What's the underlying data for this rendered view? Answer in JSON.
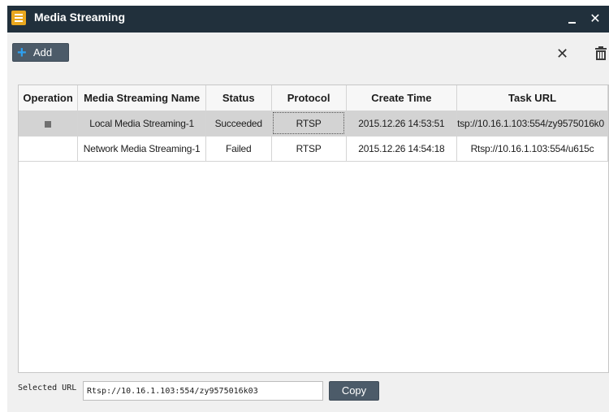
{
  "window": {
    "title": "Media Streaming",
    "minimize_icon": "minimize-icon",
    "close_icon": "close-icon",
    "title_bar_color": "#21303c",
    "accent_color": "#e9a71e"
  },
  "toolbar": {
    "add_label": "Add",
    "add_icon": "plus-icon",
    "delete_icon": "x-icon",
    "trash_icon": "trash-icon"
  },
  "table": {
    "columns": [
      "Operation",
      "Media Streaming Name",
      "Status",
      "Protocol",
      "Create Time",
      "Task URL"
    ],
    "rows": [
      {
        "operation_icon": "square-icon",
        "name": "Local Media Streaming-1",
        "status": "Succeeded",
        "protocol": "RTSP",
        "create_time": "2015.12.26 14:53:51",
        "task_url": "tsp://10.16.1.103:554/zy9575016k0",
        "selected": true
      },
      {
        "operation_icon": "",
        "name": "Network Media Streaming-1",
        "status": "Failed",
        "protocol": "RTSP",
        "create_time": "2015.12.26 14:54:18",
        "task_url": "Rtsp://10.16.1.103:554/u615c",
        "selected": false
      }
    ]
  },
  "bottom": {
    "selected_url_label": "Selected URL",
    "selected_url_value": "Rtsp://10.16.1.103:554/zy9575016k03",
    "copy_label": "Copy"
  }
}
